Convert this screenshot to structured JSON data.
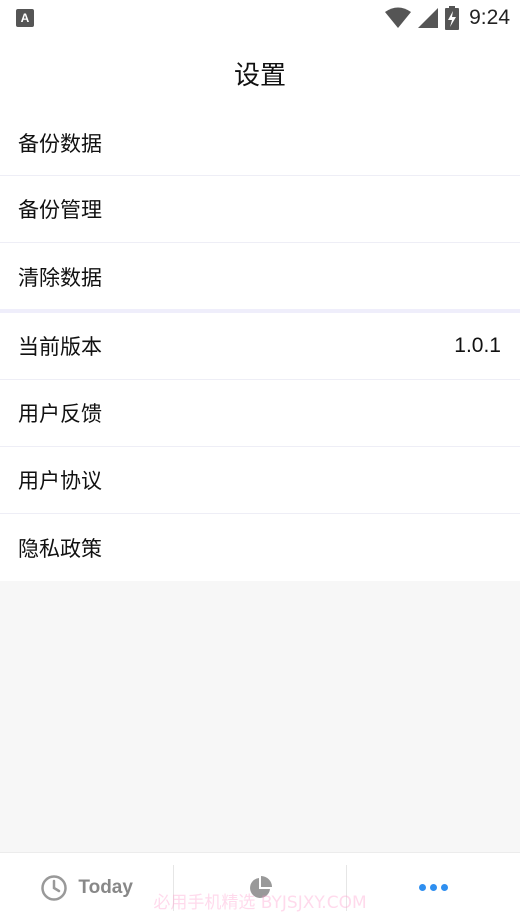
{
  "status_bar": {
    "notification_icon": "A",
    "time": "9:24"
  },
  "header": {
    "title": "设置"
  },
  "settings_group_1": [
    {
      "label": "备份数据"
    },
    {
      "label": "备份管理"
    },
    {
      "label": "清除数据"
    }
  ],
  "settings_group_2": [
    {
      "label": "当前版本",
      "value": "1.0.1"
    },
    {
      "label": "用户反馈"
    },
    {
      "label": "用户协议"
    },
    {
      "label": "隐私政策"
    }
  ],
  "tab_bar": {
    "today_label": "Today",
    "active_tab": "more",
    "accent_color": "#2f8ff0"
  },
  "watermark": "必用手机精选 BYJSJXY.COM"
}
